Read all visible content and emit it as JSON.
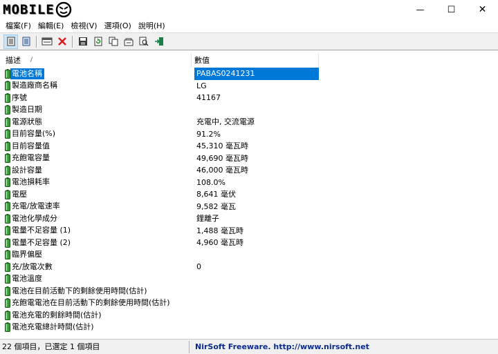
{
  "app": {
    "logo_text": "MOBILE"
  },
  "window_controls": [
    "—",
    "☐",
    "✕"
  ],
  "menu": [
    "檔案(F)",
    "編輯(E)",
    "檢視(V)",
    "選項(O)",
    "說明(H)"
  ],
  "toolbar": {
    "icons": [
      "html-report-icon",
      "text-report-icon",
      "properties-icon",
      "delete-icon",
      "save-icon",
      "refresh-icon",
      "copy-icon",
      "options-icon",
      "find-icon",
      "exit-icon"
    ]
  },
  "columns": {
    "description": "描述",
    "value": "數值",
    "sort_indicator": "/"
  },
  "rows": [
    {
      "desc": "電池名稱",
      "value": "PABAS0241231"
    },
    {
      "desc": "製造廠商名稱",
      "value": "LG"
    },
    {
      "desc": "序號",
      "value": "41167"
    },
    {
      "desc": "製造日期",
      "value": ""
    },
    {
      "desc": "電源狀態",
      "value": "充電中, 交流電源"
    },
    {
      "desc": "目前容量(%)",
      "value": "91.2%"
    },
    {
      "desc": "目前容量值",
      "value": "45,310 毫瓦時"
    },
    {
      "desc": "充飽電容量",
      "value": "49,690 毫瓦時"
    },
    {
      "desc": "設計容量",
      "value": "46,000 毫瓦時"
    },
    {
      "desc": "電池損耗率",
      "value": "108.0%"
    },
    {
      "desc": "電壓",
      "value": "8,641 毫伏"
    },
    {
      "desc": "充電/放電速率",
      "value": "9,582 毫瓦"
    },
    {
      "desc": "電池化學成分",
      "value": "鋰離子"
    },
    {
      "desc": "電量不足容量 (1)",
      "value": "1,488 毫瓦時"
    },
    {
      "desc": "電量不足容量 (2)",
      "value": "4,960 毫瓦時"
    },
    {
      "desc": "臨界偏壓",
      "value": ""
    },
    {
      "desc": "充/放電次數",
      "value": "0"
    },
    {
      "desc": "電池溫度",
      "value": ""
    },
    {
      "desc": "電池在目前活動下的剩餘使用時間(估計)",
      "value": ""
    },
    {
      "desc": "充飽電電池在目前活動下的剩餘使用時間(估計)",
      "value": ""
    },
    {
      "desc": "電池充電的剩餘時間(估計)",
      "value": ""
    },
    {
      "desc": "電池充電總計時間(估計)",
      "value": ""
    }
  ],
  "selected_row": 0,
  "status": {
    "items": "22 個項目，已選定 1 個項目",
    "credit": "NirSoft Freeware.  http://www.nirsoft.net"
  },
  "colors": {
    "selection": "#0078d7",
    "battery": "#3a9a3a",
    "credit": "#0b2b8c"
  }
}
